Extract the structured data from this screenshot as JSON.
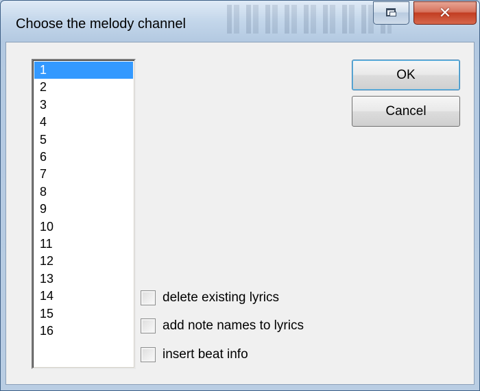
{
  "window": {
    "title": "Choose the melody channel"
  },
  "channels": {
    "items": [
      "1",
      "2",
      "3",
      "4",
      "5",
      "6",
      "7",
      "8",
      "9",
      "10",
      "11",
      "12",
      "13",
      "14",
      "15",
      "16"
    ],
    "selected": "1"
  },
  "buttons": {
    "ok": "OK",
    "cancel": "Cancel"
  },
  "options": {
    "delete_lyrics": {
      "label": "delete existing lyrics",
      "checked": false
    },
    "add_note_names": {
      "label": "add note names to lyrics",
      "checked": false
    },
    "insert_beat": {
      "label": "insert beat info",
      "checked": false
    }
  },
  "colors": {
    "selection": "#3399ff",
    "close_button": "#c23d22"
  }
}
